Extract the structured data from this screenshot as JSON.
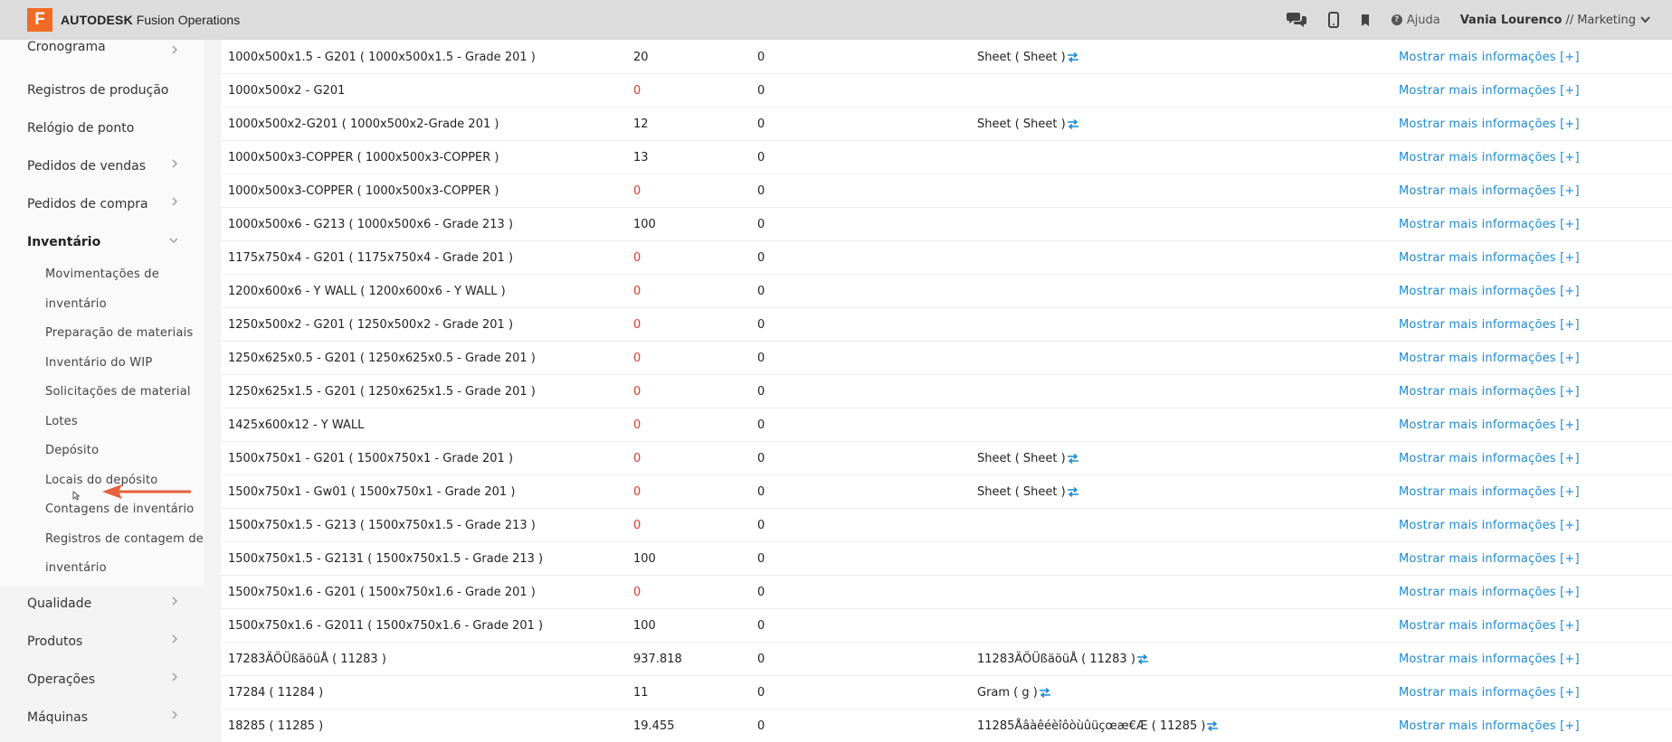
{
  "header": {
    "logo_letter": "F",
    "brand": "AUTODESK",
    "product": "Fusion Operations",
    "help_label": "Ajuda",
    "user_name": "Vania Lourenco",
    "user_separator": "//",
    "user_department": "Marketing"
  },
  "sidebar": {
    "items": [
      {
        "label": "Cronograma",
        "has_chevron": true
      },
      {
        "label": "Registros de produção",
        "has_chevron": false
      },
      {
        "label": "Relógio de ponto",
        "has_chevron": false
      },
      {
        "label": "Pedidos de vendas",
        "has_chevron": true
      },
      {
        "label": "Pedidos de compra",
        "has_chevron": true
      },
      {
        "label": "Inventário",
        "expanded": true
      },
      {
        "label": "Qualidade",
        "has_chevron": true
      },
      {
        "label": "Produtos",
        "has_chevron": true
      },
      {
        "label": "Operações",
        "has_chevron": true
      },
      {
        "label": "Máquinas",
        "has_chevron": true
      }
    ],
    "inventory_sub": [
      "Movimentações de",
      "inventário",
      "Preparação de materiais",
      "Inventário do WIP",
      "Solicitações de material",
      "Lotes",
      "Depósito",
      "Locais do depósito",
      "Contagens de inventário",
      "Registros de contagem de",
      "inventário"
    ]
  },
  "table": {
    "link_label": "Mostrar mais informações [+]",
    "rows": [
      {
        "name": "1000x500x1.5 - G201 ( 1000x500x1.5 - Grade 201 )",
        "qty": "20",
        "b": "0",
        "unit": "Sheet ( Sheet )"
      },
      {
        "name": "1000x500x2 - G201",
        "qty": "0",
        "b": "0",
        "unit": ""
      },
      {
        "name": "1000x500x2-G201 ( 1000x500x2-Grade 201 )",
        "qty": "12",
        "b": "0",
        "unit": "Sheet ( Sheet )"
      },
      {
        "name": "1000x500x3-COPPER ( 1000x500x3-COPPER )",
        "qty": "13",
        "b": "0",
        "unit": ""
      },
      {
        "name": "1000x500x3-COPPER ( 1000x500x3-COPPER )",
        "qty": "0",
        "b": "0",
        "unit": ""
      },
      {
        "name": "1000x500x6 - G213 ( 1000x500x6 - Grade 213 )",
        "qty": "100",
        "b": "0",
        "unit": ""
      },
      {
        "name": "1175x750x4 - G201 ( 1175x750x4 - Grade 201 )",
        "qty": "0",
        "b": "0",
        "unit": ""
      },
      {
        "name": "1200x600x6 - Y WALL ( 1200x600x6 - Y WALL )",
        "qty": "0",
        "b": "0",
        "unit": ""
      },
      {
        "name": "1250x500x2 - G201 ( 1250x500x2 - Grade 201 )",
        "qty": "0",
        "b": "0",
        "unit": ""
      },
      {
        "name": "1250x625x0.5 - G201 ( 1250x625x0.5 - Grade 201 )",
        "qty": "0",
        "b": "0",
        "unit": ""
      },
      {
        "name": "1250x625x1.5 - G201 ( 1250x625x1.5 - Grade 201 )",
        "qty": "0",
        "b": "0",
        "unit": ""
      },
      {
        "name": "1425x600x12 - Y WALL",
        "qty": "0",
        "b": "0",
        "unit": ""
      },
      {
        "name": "1500x750x1 - G201 ( 1500x750x1 - Grade 201 )",
        "qty": "0",
        "b": "0",
        "unit": "Sheet ( Sheet )"
      },
      {
        "name": "1500x750x1 - Gw01 ( 1500x750x1 - Grade 201 )",
        "qty": "0",
        "b": "0",
        "unit": "Sheet ( Sheet )"
      },
      {
        "name": "1500x750x1.5 - G213 ( 1500x750x1.5 - Grade 213 )",
        "qty": "0",
        "b": "0",
        "unit": ""
      },
      {
        "name": "1500x750x1.5 - G2131 ( 1500x750x1.5 - Grade 213 )",
        "qty": "100",
        "b": "0",
        "unit": ""
      },
      {
        "name": "1500x750x1.6 - G201 ( 1500x750x1.6 - Grade 201 )",
        "qty": "0",
        "b": "0",
        "unit": ""
      },
      {
        "name": "1500x750x1.6 - G2011 ( 1500x750x1.6 - Grade 201 )",
        "qty": "100",
        "b": "0",
        "unit": ""
      },
      {
        "name": "17283ÄÖÜßäöüÅ ( 11283 )",
        "qty": "937.818",
        "b": "0",
        "unit": "11283ÄÖÜßäöüÅ ( 11283 )"
      },
      {
        "name": "17284 ( 11284 )",
        "qty": "11",
        "b": "0",
        "unit": "Gram ( g )"
      },
      {
        "name": "18285 ( 11285 )",
        "qty": "19.455",
        "b": "0",
        "unit": "11285Åâàêéèîôòùûüçœæ€Æ ( 11285 )"
      }
    ]
  },
  "colors": {
    "brand_orange": "#f26b24",
    "link_blue": "#1a8ad4",
    "zero_red": "#e03a2a",
    "annotation_arrow": "#e8603c"
  }
}
